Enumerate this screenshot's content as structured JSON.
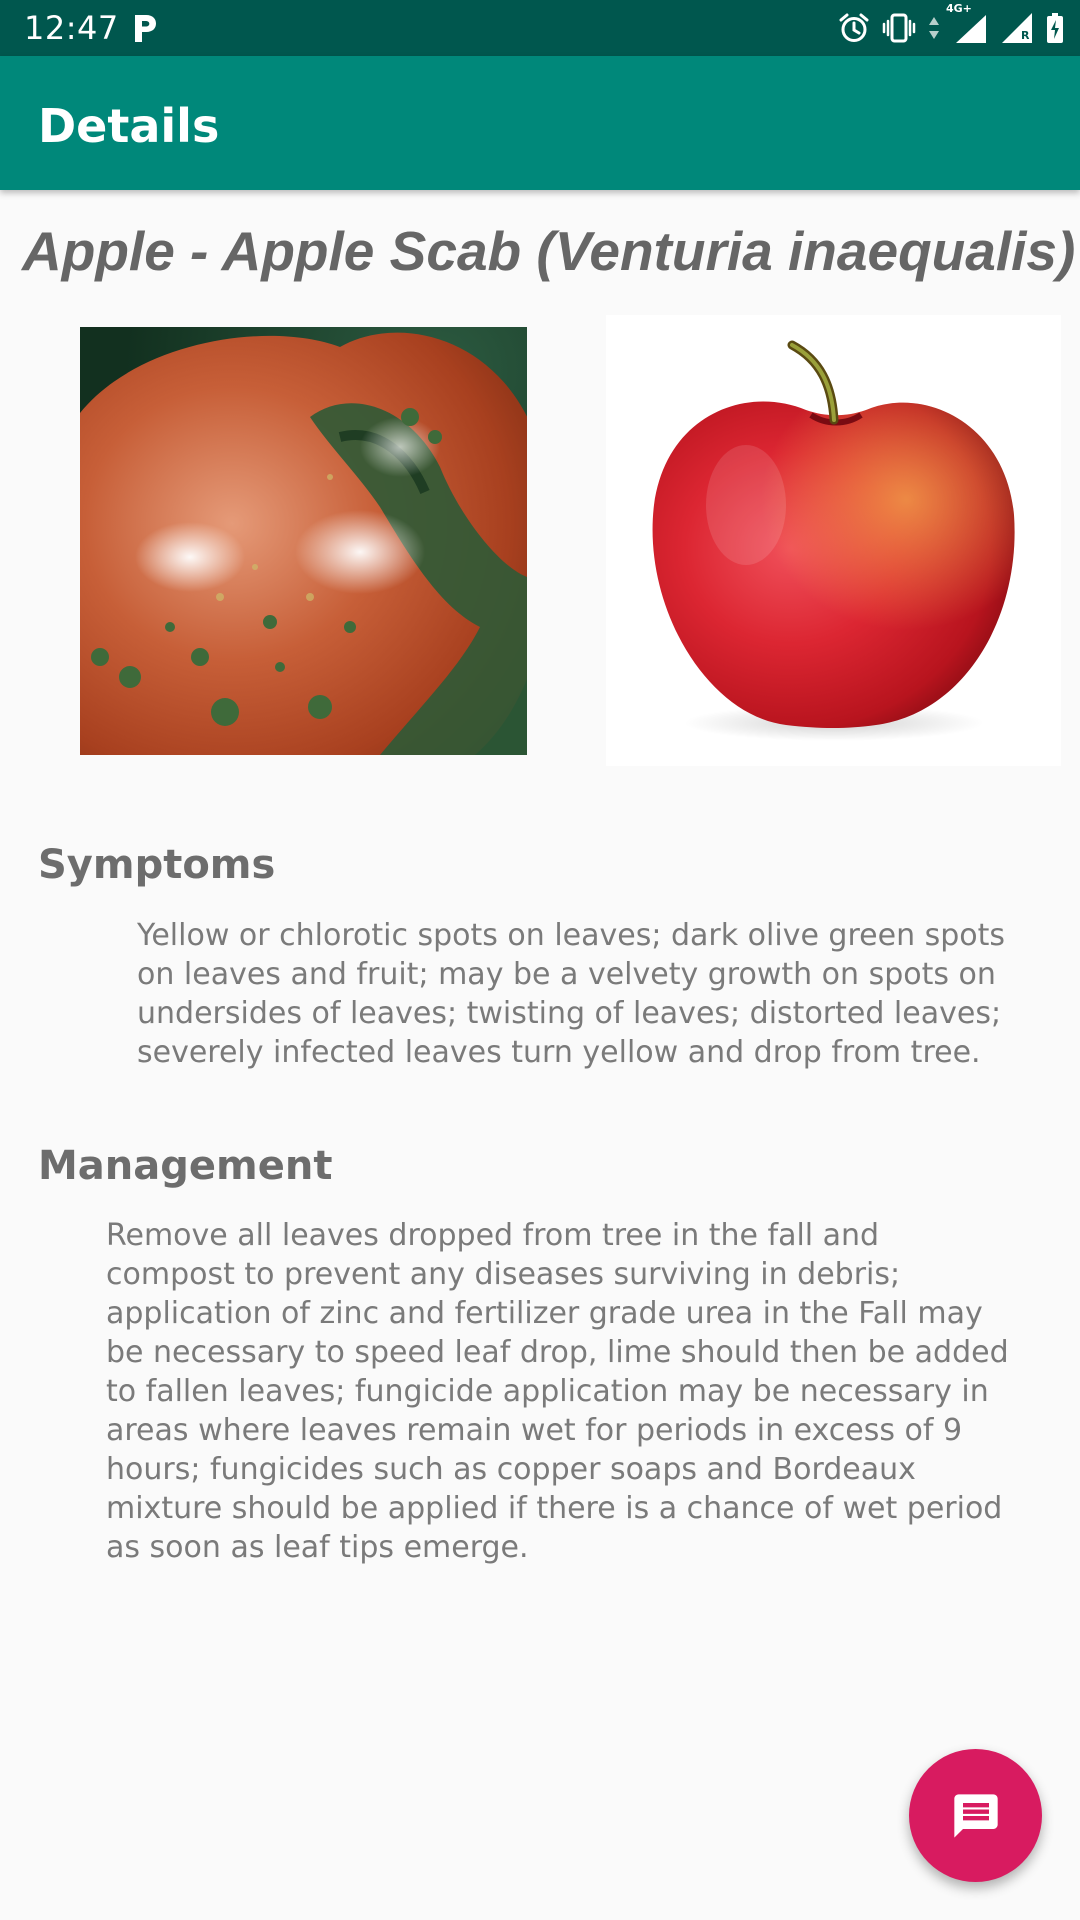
{
  "status_bar": {
    "time": "12:47",
    "icons": [
      "parking-p-icon",
      "alarm-clock-icon",
      "vibrate-icon",
      "data-arrows-icon",
      "signal-4g-icon",
      "signal-roaming-icon",
      "battery-charging-icon"
    ],
    "network_label": "4G+",
    "roaming_label": "R"
  },
  "app_bar": {
    "title": "Details"
  },
  "disease": {
    "title": "Apple - Apple Scab (Venturia inaequalis)"
  },
  "images": {
    "diseased": "apple-scab-fruit-image",
    "healthy": "healthy-apple-image"
  },
  "symptoms": {
    "heading": "Symptoms",
    "body": "Yellow or chlorotic spots on leaves; dark olive green spots on leaves and fruit; may be a velvety growth on spots on undersides of leaves; twisting of leaves; distorted leaves; severely infected leaves turn yellow and drop from tree."
  },
  "management": {
    "heading": "Management",
    "body": "Remove all leaves dropped from tree in the fall and compost to prevent any diseases surviving in debris; application of zinc and fertilizer grade urea in the Fall may be necessary to speed leaf drop, lime should then be added to fallen leaves; fungicide application may be necessary in areas where leaves remain wet for periods in excess of 9 hours; fungicides such as copper soaps and Bordeaux mixture should be applied if there is a chance of wet period as soon as leaf tips emerge."
  },
  "fab": {
    "icon": "chat-message-icon"
  },
  "colors": {
    "status_bar": "#00574e",
    "app_bar": "#00887a",
    "fab": "#d81b60",
    "background": "#fafafa"
  }
}
